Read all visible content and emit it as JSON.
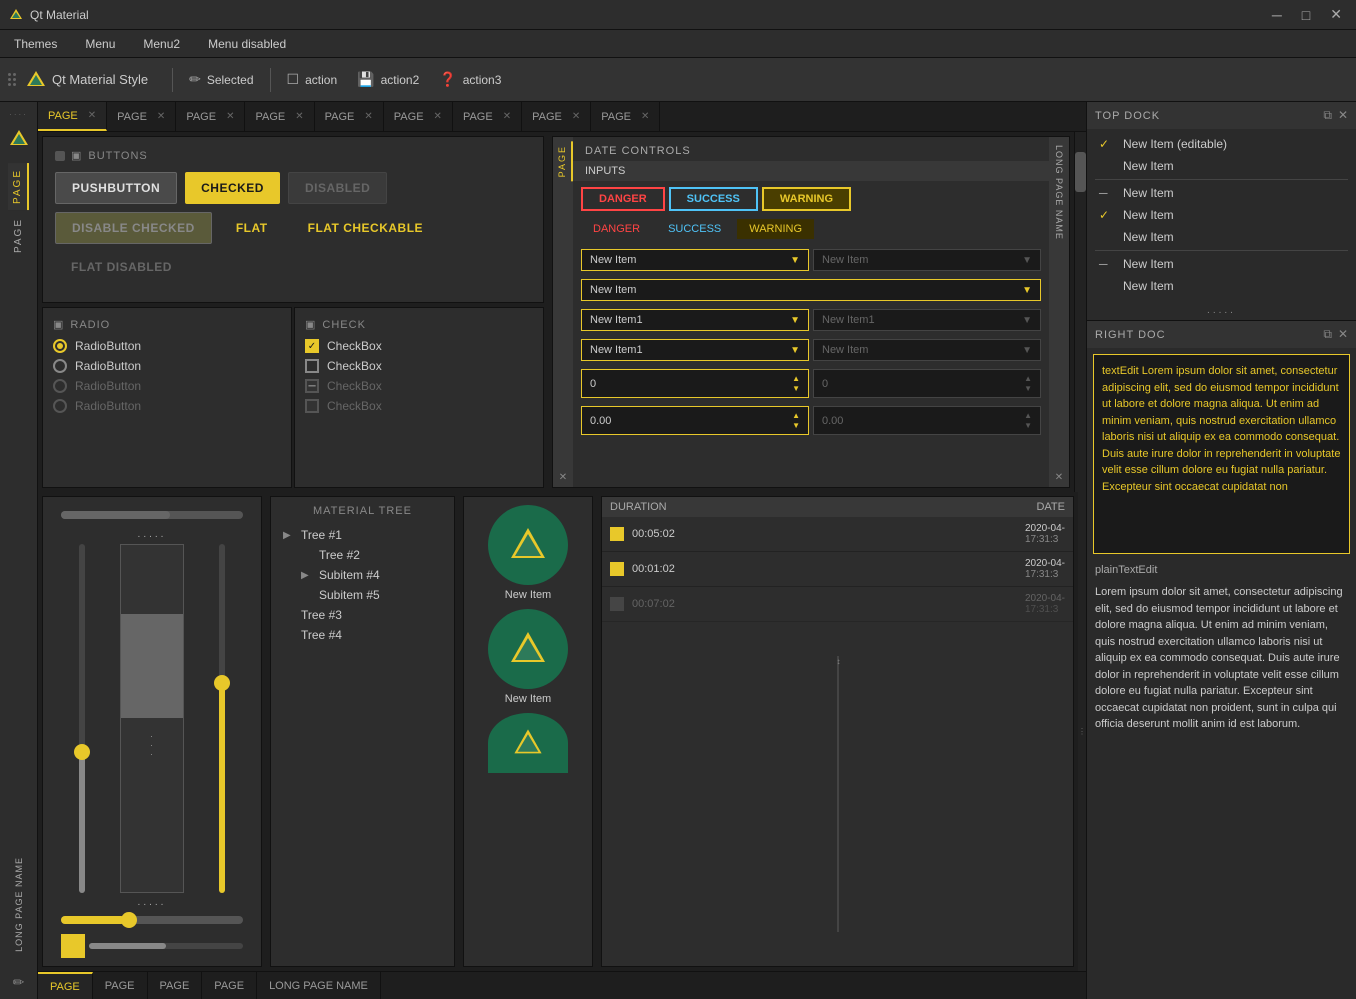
{
  "titlebar": {
    "title": "Qt Material",
    "min_btn": "─",
    "max_btn": "□",
    "close_btn": "✕"
  },
  "menubar": {
    "items": [
      "Themes",
      "Menu",
      "Menu2",
      "Menu disabled"
    ]
  },
  "toolbar": {
    "app_name": "Qt Material Style",
    "actions": [
      {
        "label": "Selected",
        "icon": "pencil"
      },
      {
        "label": "action",
        "icon": "square-outline"
      },
      {
        "label": "action2",
        "icon": "floppy"
      },
      {
        "label": "action3",
        "icon": "help-circle"
      }
    ]
  },
  "left_vtabs": {
    "items": [
      "PAGE",
      "PAGE",
      "LONG PAGE NAME"
    ]
  },
  "top_tabs": {
    "items": [
      "PAGE",
      "PAGE",
      "PAGE",
      "PAGE",
      "PAGE",
      "PAGE",
      "PAGE",
      "PAGE",
      "PAGE"
    ]
  },
  "buttons_section": {
    "title": "BUTTONS",
    "pushbutton": "PUSHBUTTON",
    "checked": "CHECKED",
    "disabled": "DISABLED",
    "disable_checked": "DISABLE CHECKED",
    "flat": "FLAT",
    "flat_checkable": "FLAT CHECKABLE",
    "flat_disabled": "FLAT DISABLED"
  },
  "radio_section": {
    "title": "RADIO",
    "items": [
      "RadioButton",
      "RadioButton",
      "RadioButton",
      "RadioButton"
    ],
    "states": [
      "selected",
      "normal",
      "disabled",
      "disabled"
    ]
  },
  "check_section": {
    "title": "CHECK",
    "items": [
      "CheckBox",
      "CheckBox",
      "CheckBox",
      "CheckBox"
    ],
    "states": [
      "checked-filled",
      "unchecked",
      "disabled-checked",
      "unchecked"
    ]
  },
  "date_controls": {
    "title": "DATE CONTROLS",
    "inputs_label": "INPUTS",
    "badges": {
      "danger": "DANGER",
      "success": "SUCCESS",
      "warning": "WARNING"
    },
    "text_labels": {
      "danger": "DANGER",
      "success": "SUCCESS",
      "warning": "WARNING"
    },
    "combos": [
      {
        "value": "New Item",
        "placeholder": "New Item",
        "disabled": false
      },
      {
        "value": "New Item",
        "placeholder": "",
        "disabled": false
      },
      {
        "value": "New Item1",
        "placeholder": "New Item1",
        "disabled": false
      },
      {
        "value": "New Item1",
        "placeholder": "New Item",
        "disabled": false
      }
    ],
    "spinboxes": [
      {
        "value": "0",
        "placeholder": "0"
      },
      {
        "value": "0.00",
        "placeholder": "0.00"
      }
    ],
    "vtab_left": "PAGE",
    "vtab_right": "LONG PAGE NAME"
  },
  "lower_panels": {
    "panel1_items": [
      ".....",
      "....."
    ],
    "panel2_label": "MATERIAL TREE",
    "tree_items": [
      {
        "label": "Tree #1",
        "level": 0,
        "expandable": true
      },
      {
        "label": "Tree #2",
        "level": 1,
        "expandable": false
      },
      {
        "label": "Subitem #4",
        "level": 1,
        "expandable": false
      },
      {
        "label": "Subitem #5",
        "level": 1,
        "expandable": false
      },
      {
        "label": "Tree #3",
        "level": 0,
        "expandable": false
      },
      {
        "label": "Tree #4",
        "level": 0,
        "expandable": false
      }
    ],
    "icon_cards": [
      "New Item",
      "New Item"
    ],
    "duration_panel": {
      "col1": "DURATION",
      "col2": "DATE",
      "rows": [
        {
          "check": true,
          "duration": "00:05:02",
          "date": "2020-04-",
          "time": "17:31:3"
        },
        {
          "check": true,
          "duration": "00:01:02",
          "date": "2020-04-",
          "time": "17:31:3"
        },
        {
          "check": false,
          "duration": "00:07:02",
          "date": "2020-04-",
          "time": "17:31:3"
        }
      ]
    }
  },
  "bottom_tabs": {
    "items": [
      "PAGE",
      "PAGE",
      "PAGE",
      "PAGE",
      "LONG PAGE NAME"
    ]
  },
  "right_top_dock": {
    "title": "TOP DOCK",
    "list_items": [
      {
        "mark": "check",
        "label": "New Item (editable)"
      },
      {
        "mark": "none",
        "label": "New Item"
      },
      {
        "mark": "dash",
        "label": "New Item"
      },
      {
        "mark": "check",
        "label": "New Item"
      },
      {
        "mark": "none",
        "label": "New Item"
      },
      {
        "mark": "dash",
        "label": "New Item"
      },
      {
        "mark": "none",
        "label": "New Item"
      }
    ]
  },
  "right_doc": {
    "title": "RIGHT DOC",
    "text_edit_content": "textEdit Lorem ipsum dolor sit amet, consectetur adipiscing elit, sed do eiusmod tempor incididunt ut labore et dolore magna aliqua. Ut enim ad minim veniam, quis nostrud exercitation ullamco laboris nisi ut aliquip ex ea commodo consequat. Duis aute irure dolor in reprehenderit in voluptate velit esse cillum dolore eu fugiat nulla pariatur. Excepteur sint occaecat cupidatat non",
    "plain_text_label": "plainTextEdit",
    "plain_text_content": "Lorem ipsum dolor sit amet, consectetur adipiscing elit, sed do eiusmod tempor incididunt ut labore et dolore magna aliqua. Ut enim ad minim veniam, quis nostrud exercitation ullamco laboris nisi ut aliquip ex ea commodo consequat. Duis aute irure dolor in reprehenderit in voluptate velit esse cillum dolore eu fugiat nulla pariatur. Excepteur sint occaecat cupidatat non proident, sunt in culpa qui officia deserunt mollit anim id est laborum."
  },
  "colors": {
    "accent": "#e8c82a",
    "danger": "#f44336",
    "success": "#4fc3f7",
    "warning": "#e8c82a",
    "bg_dark": "#1e1e1e",
    "bg_panel": "#2d2d2d",
    "text_primary": "#cccccc",
    "text_muted": "#888888"
  }
}
